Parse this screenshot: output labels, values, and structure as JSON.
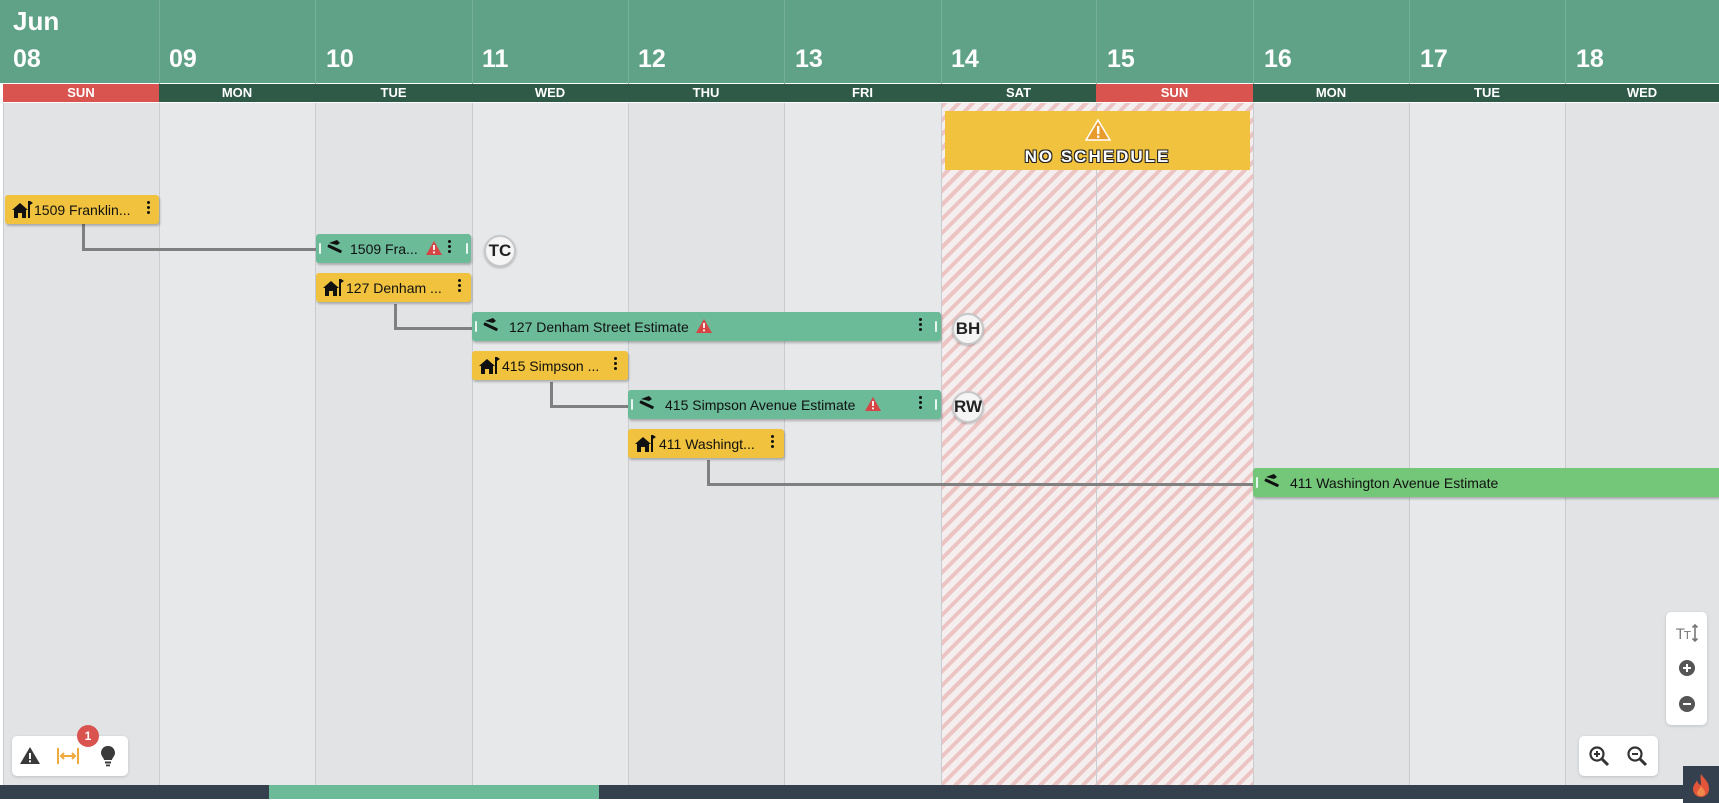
{
  "header": {
    "month": "Jun"
  },
  "days": [
    {
      "num": "08",
      "dow": "SUN",
      "weekend": true
    },
    {
      "num": "09",
      "dow": "MON",
      "weekend": false
    },
    {
      "num": "10",
      "dow": "TUE",
      "weekend": false
    },
    {
      "num": "11",
      "dow": "WED",
      "weekend": false
    },
    {
      "num": "12",
      "dow": "THU",
      "weekend": false
    },
    {
      "num": "13",
      "dow": "FRI",
      "weekend": false
    },
    {
      "num": "14",
      "dow": "SAT",
      "weekend": false
    },
    {
      "num": "15",
      "dow": "SUN",
      "weekend": true
    },
    {
      "num": "16",
      "dow": "MON",
      "weekend": false
    },
    {
      "num": "17",
      "dow": "TUE",
      "weekend": false
    },
    {
      "num": "18",
      "dow": "WED",
      "weekend": false
    }
  ],
  "no_schedule": {
    "label": "NO SCHEDULE",
    "icon": "warning-icon"
  },
  "tasks": [
    {
      "id": "t1",
      "label": "1509 Franklin...",
      "type": "site",
      "color": "yellow",
      "icon": "house-flag-icon"
    },
    {
      "id": "t2",
      "label": "1509 Fra...",
      "type": "estimate",
      "color": "teal",
      "icon": "hammer-icon",
      "warning": true,
      "assignee": "TC"
    },
    {
      "id": "t3",
      "label": "127 Denham ...",
      "type": "site",
      "color": "yellow",
      "icon": "house-flag-icon"
    },
    {
      "id": "t4",
      "label": "127 Denham Street Estimate",
      "type": "estimate",
      "color": "teal",
      "icon": "hammer-icon",
      "warning": true,
      "assignee": "BH"
    },
    {
      "id": "t5",
      "label": "415 Simpson ...",
      "type": "site",
      "color": "yellow",
      "icon": "house-flag-icon"
    },
    {
      "id": "t6",
      "label": "415 Simpson Avenue Estimate",
      "type": "estimate",
      "color": "teal",
      "icon": "hammer-icon",
      "warning": true,
      "assignee": "RW"
    },
    {
      "id": "t7",
      "label": "411 Washingt...",
      "type": "site",
      "color": "yellow",
      "icon": "house-flag-icon"
    },
    {
      "id": "t8",
      "label": "411 Washington Avenue Estimate",
      "type": "estimate",
      "color": "green",
      "icon": "hammer-icon"
    }
  ],
  "bottom_toolbar": {
    "items": [
      "warning-icon",
      "fit-width-icon",
      "lightbulb-icon"
    ],
    "badge_count": "1"
  },
  "side_toolbar": {
    "items": [
      "text-height-icon",
      "plus-circle-icon",
      "minus-circle-icon"
    ]
  },
  "zoom_toolbar": {
    "items": [
      "zoom-in-icon",
      "zoom-out-icon"
    ]
  },
  "colors": {
    "header": "#5fa287",
    "weekday_bar": "#2f5a48",
    "weekend_bar": "#d9534f",
    "site_task": "#f0c23d",
    "estimate_task": "#6bba98",
    "estimate_active": "#74c778",
    "no_schedule": "#f0c23d",
    "warning_red": "#d64545"
  }
}
